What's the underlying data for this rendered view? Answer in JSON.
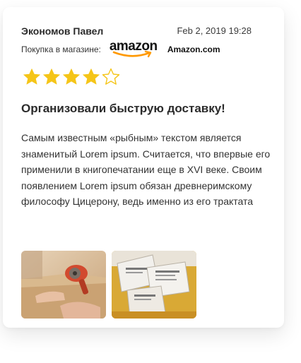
{
  "review": {
    "author": "Экономов Павел",
    "date": "Feb 2, 2019 19:28",
    "store_label": "Покупка в магазине:",
    "store_logo_text": "amazon",
    "store_name": "Amazon.com",
    "rating": 4,
    "rating_max": 5,
    "title": "Организовали быструю доставку!",
    "text": "Самым известным «рыбным» текстом является знаменитый Lorem ipsum. Считается, что впервые его применили в книгопечатании еще в XVI веке. Своим появлением Lorem ipsum обязан древнеримскому философу Цицерону, ведь именно из его трактата",
    "photos": [
      {
        "icon": "photo-packing-tape"
      },
      {
        "icon": "photo-parcels"
      }
    ]
  },
  "colors": {
    "star_filled": "#F5C518",
    "star_empty_stroke": "#F5C518",
    "amazon_smile": "#FF9900"
  }
}
